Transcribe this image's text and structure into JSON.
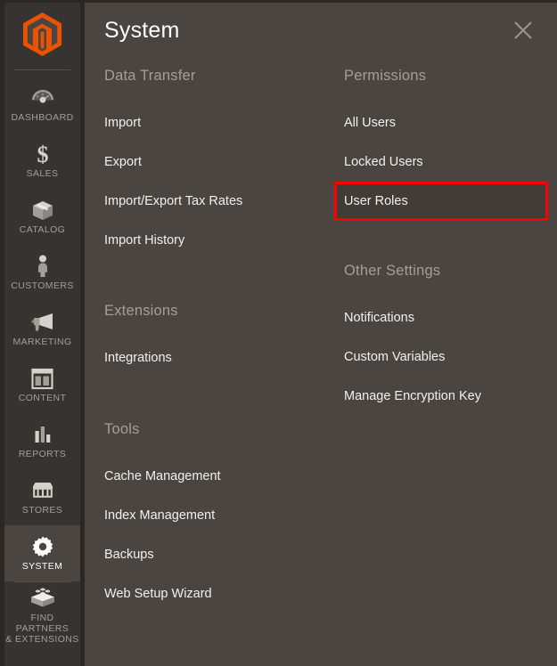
{
  "theme": {
    "sidebar_bg": "#373330",
    "sidebar_active_bg": "#4a4541",
    "panel_bg": "#4a4541",
    "accent_orange": "#eb5202",
    "text_primary": "#f2f0ee",
    "text_muted": "#a49e97",
    "highlight_border": "#ff0000"
  },
  "sidebar": {
    "logo_name": "magento-logo",
    "items": [
      {
        "label": "DASHBOARD",
        "icon": "dashboard-gauge-icon",
        "active": false
      },
      {
        "label": "SALES",
        "icon": "dollar-sign-icon",
        "active": false
      },
      {
        "label": "CATALOG",
        "icon": "box-package-icon",
        "active": false
      },
      {
        "label": "CUSTOMERS",
        "icon": "person-icon",
        "active": false
      },
      {
        "label": "MARKETING",
        "icon": "megaphone-icon",
        "active": false
      },
      {
        "label": "CONTENT",
        "icon": "layout-page-icon",
        "active": false
      },
      {
        "label": "REPORTS",
        "icon": "bar-chart-icon",
        "active": false
      },
      {
        "label": "STORES",
        "icon": "storefront-icon",
        "active": false
      },
      {
        "label": "SYSTEM",
        "icon": "gear-icon",
        "active": true
      },
      {
        "label": "FIND PARTNERS\n& EXTENSIONS",
        "label_line1": "FIND PARTNERS",
        "label_line2": "& EXTENSIONS",
        "icon": "lego-brick-icon",
        "active": false
      }
    ]
  },
  "panel": {
    "title": "System",
    "close_icon": "close-icon",
    "columns": {
      "left": [
        {
          "title": "Data Transfer",
          "items": [
            {
              "label": "Import",
              "highlighted": false
            },
            {
              "label": "Export",
              "highlighted": false
            },
            {
              "label": "Import/Export Tax Rates",
              "highlighted": false
            },
            {
              "label": "Import History",
              "highlighted": false
            }
          ]
        },
        {
          "title": "Extensions",
          "items": [
            {
              "label": "Integrations",
              "highlighted": false
            }
          ]
        },
        {
          "title": "Tools",
          "items": [
            {
              "label": "Cache Management",
              "highlighted": false
            },
            {
              "label": "Index Management",
              "highlighted": false
            },
            {
              "label": "Backups",
              "highlighted": false
            },
            {
              "label": "Web Setup Wizard",
              "highlighted": false
            }
          ]
        }
      ],
      "right": [
        {
          "title": "Permissions",
          "items": [
            {
              "label": "All Users",
              "highlighted": false
            },
            {
              "label": "Locked Users",
              "highlighted": false
            },
            {
              "label": "User Roles",
              "highlighted": true
            }
          ]
        },
        {
          "title": "Other Settings",
          "items": [
            {
              "label": "Notifications",
              "highlighted": false
            },
            {
              "label": "Custom Variables",
              "highlighted": false
            },
            {
              "label": "Manage Encryption Key",
              "highlighted": false
            }
          ]
        }
      ]
    }
  }
}
